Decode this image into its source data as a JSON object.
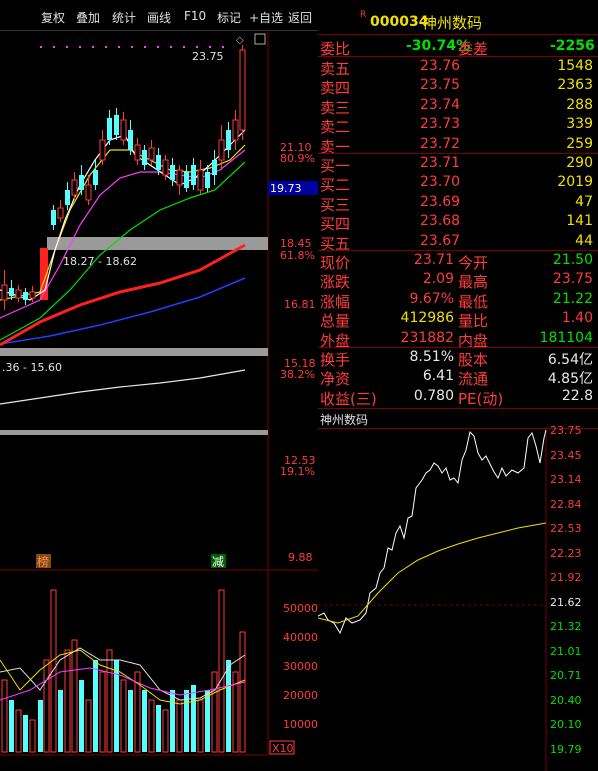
{
  "toolbar": {
    "items": [
      "复权",
      "叠加",
      "统计",
      "画线",
      "F10",
      "标记",
      "+自选",
      "返回"
    ]
  },
  "kchart": {
    "high_label": "23.75",
    "band1": "18.27 - 18.62",
    "band2": ".36 - 15.60",
    "price_axis": [
      "21.10",
      "19.73",
      "18.45",
      "16.81",
      "15.18",
      "12.53",
      "9.88"
    ],
    "pct_axis": [
      "80.9%",
      "61.8%",
      "38.2%",
      "19.1%"
    ],
    "current": "19.73",
    "tag_bang": "榜",
    "tag_jian": "减",
    "vol_axis": [
      "50000",
      "40000",
      "30000",
      "20000",
      "10000"
    ],
    "vol_unit": "X10"
  },
  "quote": {
    "flag": "R",
    "code": "000034",
    "name": "神州数码",
    "weibi_label": "委比",
    "weibi_value": "-30.74%",
    "weicha_label": "委差",
    "weicha_value": "-2256",
    "asks": [
      {
        "label": "卖五",
        "price": "23.76",
        "vol": "1548"
      },
      {
        "label": "卖四",
        "price": "23.75",
        "vol": "2363"
      },
      {
        "label": "卖三",
        "price": "23.74",
        "vol": "288"
      },
      {
        "label": "卖二",
        "price": "23.73",
        "vol": "339"
      },
      {
        "label": "卖一",
        "price": "23.72",
        "vol": "259"
      }
    ],
    "bids": [
      {
        "label": "买一",
        "price": "23.71",
        "vol": "290"
      },
      {
        "label": "买二",
        "price": "23.70",
        "vol": "2019"
      },
      {
        "label": "买三",
        "price": "23.69",
        "vol": "47"
      },
      {
        "label": "买四",
        "price": "23.68",
        "vol": "141"
      },
      {
        "label": "买五",
        "price": "23.67",
        "vol": "44"
      }
    ],
    "stats": [
      {
        "l1": "现价",
        "v1": "23.71",
        "c1": "red",
        "l2": "今开",
        "v2": "21.50",
        "c2": "grn"
      },
      {
        "l1": "涨跌",
        "v1": "2.09",
        "c1": "red",
        "l2": "最高",
        "v2": "23.75",
        "c2": "red"
      },
      {
        "l1": "涨幅",
        "v1": "9.67%",
        "c1": "red",
        "l2": "最低",
        "v2": "21.22",
        "c2": "grn"
      },
      {
        "l1": "总量",
        "v1": "412986",
        "c1": "yel",
        "l2": "量比",
        "v2": "1.40",
        "c2": "red"
      },
      {
        "l1": "外盘",
        "v1": "231882",
        "c1": "red",
        "l2": "内盘",
        "v2": "181104",
        "c2": "grn"
      }
    ],
    "fin": [
      {
        "l1": "换手",
        "v1": "8.51%",
        "l2": "股本",
        "v2": "6.54亿"
      },
      {
        "l1": "净资",
        "v1": "6.41",
        "l2": "流通",
        "v2": "4.85亿"
      },
      {
        "l1": "收益(三)",
        "v1": "0.780",
        "l2": "PE(动)",
        "v2": "22.8"
      }
    ]
  },
  "mini": {
    "title": "神州数码",
    "axis": [
      {
        "v": "23.75",
        "c": "red"
      },
      {
        "v": "23.45",
        "c": "red"
      },
      {
        "v": "23.14",
        "c": "red"
      },
      {
        "v": "22.84",
        "c": "red"
      },
      {
        "v": "22.53",
        "c": "red"
      },
      {
        "v": "22.23",
        "c": "red"
      },
      {
        "v": "21.92",
        "c": "red"
      },
      {
        "v": "21.62",
        "c": "wht"
      },
      {
        "v": "21.32",
        "c": "grn"
      },
      {
        "v": "21.01",
        "c": "grn"
      },
      {
        "v": "20.71",
        "c": "grn"
      },
      {
        "v": "20.40",
        "c": "grn"
      },
      {
        "v": "20.10",
        "c": "grn"
      },
      {
        "v": "19.79",
        "c": "grn"
      }
    ]
  },
  "colors": {
    "up": "#ff3b3b",
    "down": "#54ffff",
    "ma5": "#ffffff",
    "ma10": "#f0e000",
    "ma20": "#ff3cff",
    "ma30": "#00e000",
    "ma60": "#ff2020",
    "ma120": "#2040ff",
    "ma250": "#ffffff"
  }
}
